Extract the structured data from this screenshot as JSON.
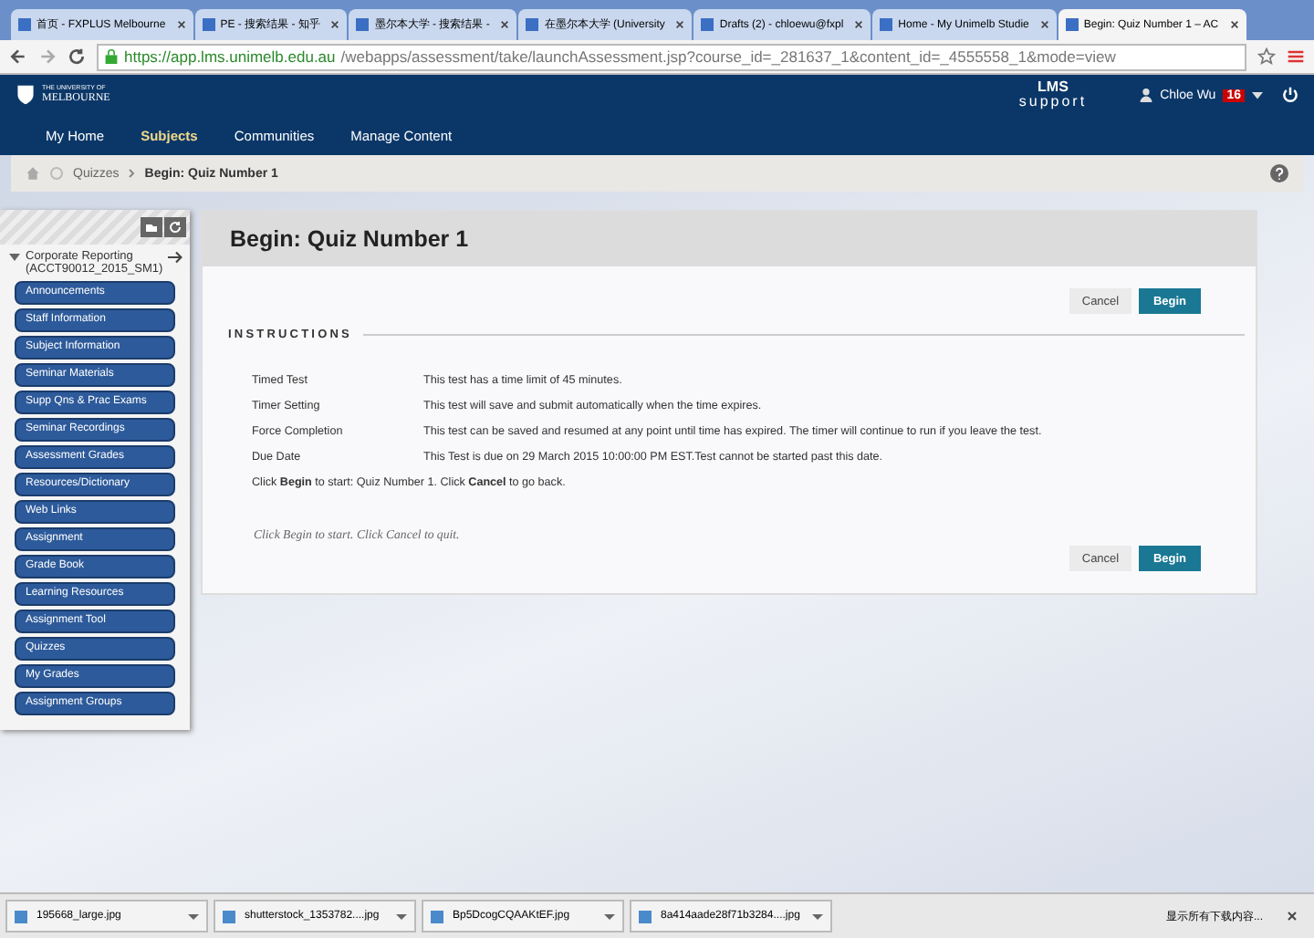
{
  "browser": {
    "tabs": [
      {
        "title": "首页 - FXPLUS Melbourne",
        "selected": false
      },
      {
        "title": "PE - 搜索结果 - 知乎",
        "selected": false
      },
      {
        "title": "墨尔本大学 - 搜索结果 -",
        "selected": false
      },
      {
        "title": "在墨尔本大学 (University",
        "selected": false
      },
      {
        "title": "Drafts (2) - chloewu@fxpl",
        "selected": false
      },
      {
        "title": "Home - My Unimelb Studie",
        "selected": false
      },
      {
        "title": "Begin: Quiz Number 1 – AC",
        "selected": true
      }
    ],
    "url_host": "https://app.lms.unimelb.edu.au",
    "url_path": "/webapps/assessment/take/launchAssessment.jsp?course_id=_281637_1&content_id=_4555558_1&mode=view"
  },
  "header": {
    "logo_small": "THE UNIVERSITY OF",
    "logo": "MELBOURNE",
    "support_line1": "LMS",
    "support_line2": "support",
    "user": "Chloe Wu",
    "badge": "16"
  },
  "nav": [
    {
      "label": "My Home",
      "selected": false
    },
    {
      "label": "Subjects",
      "selected": true
    },
    {
      "label": "Communities",
      "selected": false
    },
    {
      "label": "Manage Content",
      "selected": false
    }
  ],
  "breadcrumb": {
    "parent": "Quizzes",
    "current": "Begin: Quiz Number 1"
  },
  "sidebar": {
    "course": "Corporate Reporting (ACCT90012_2015_SM1)",
    "items": [
      "Announcements",
      "Staff Information",
      "Subject Information",
      "Seminar Materials",
      "Supp Qns & Prac Exams",
      "Seminar Recordings",
      "Assessment Grades",
      "Resources/Dictionary",
      "Web Links",
      "Assignment",
      "Grade Book",
      "Learning Resources",
      "Assignment Tool",
      "Quizzes",
      "My Grades",
      "Assignment Groups"
    ]
  },
  "page": {
    "title": "Begin: Quiz Number 1",
    "cancel": "Cancel",
    "begin": "Begin",
    "section": "INSTRUCTIONS",
    "rows": [
      {
        "label": "Timed Test",
        "value": "This test has a time limit of 45 minutes."
      },
      {
        "label": "Timer Setting",
        "value": "This test will save and submit automatically when the time expires."
      },
      {
        "label": "Force Completion",
        "value": "This test can be saved and resumed at any point until time has expired. The timer will continue to run if you leave the test."
      },
      {
        "label": "Due Date",
        "value": "This Test is due on 29 March 2015 10:00:00 PM EST.Test cannot be started past this date."
      }
    ],
    "note": "Click **Begin** to start: Quiz Number 1. Click **Cancel** to go back.",
    "hint": "Click Begin to start. Click Cancel to quit.",
    "cancel_bottom": "Cancel",
    "begin_bottom": "Begin"
  },
  "downloads": {
    "files": [
      "195668_large.jpg",
      "shutterstock_1353782....jpg",
      "Bp5DcogCQAAKtEF.jpg",
      "8a414aade28f71b3284....jpg"
    ],
    "show_all": "显示所有下载内容..."
  }
}
